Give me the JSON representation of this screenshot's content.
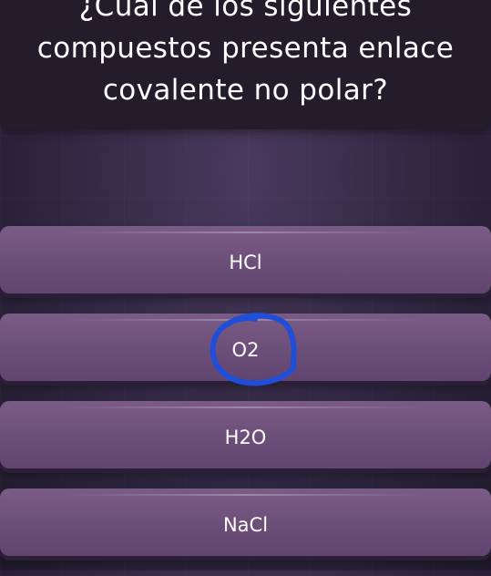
{
  "question": {
    "text": "¿Cuál de los siguientes compuestos presenta enlace covalente no polar?"
  },
  "answers": [
    {
      "label": "HCl"
    },
    {
      "label": "O2"
    },
    {
      "label": "H2O"
    },
    {
      "label": "NaCl"
    }
  ],
  "annotation": {
    "color": "#1f4fd8",
    "marks_option": "O2"
  },
  "colors": {
    "background": "#2f2640",
    "question_card": "#221c2b",
    "answer_button": "#6c4f79",
    "text": "#ffffff"
  }
}
